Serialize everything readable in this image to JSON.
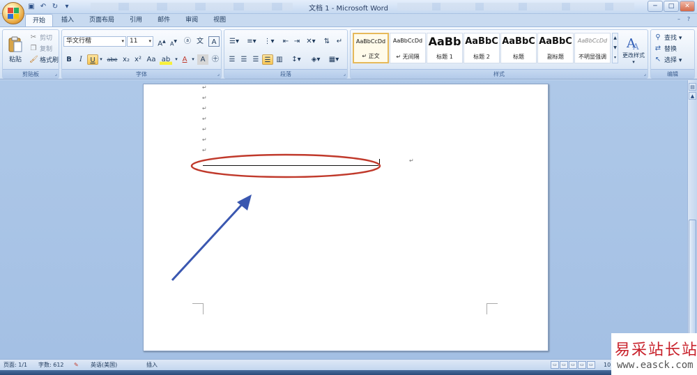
{
  "title_bar": {
    "doc_title": "文档 1 - Microsoft Word",
    "qat_icons": [
      "save-icon",
      "undo-icon",
      "redo-icon",
      "customize-icon"
    ],
    "window_buttons": [
      "─",
      "□",
      "✕"
    ]
  },
  "tabs": [
    {
      "label": "开始",
      "active": true
    },
    {
      "label": "插入"
    },
    {
      "label": "页面布局"
    },
    {
      "label": "引用"
    },
    {
      "label": "邮件"
    },
    {
      "label": "审阅"
    },
    {
      "label": "视图"
    }
  ],
  "ribbon": {
    "clipboard": {
      "label": "剪贴板",
      "paste": "粘贴",
      "cut": "剪切",
      "copy": "复制",
      "format_painter": "格式刷"
    },
    "font": {
      "label": "字体",
      "font_name": "华文行楷",
      "font_size": "11",
      "bold": "B",
      "italic": "I",
      "underline": "U",
      "strike": "abe",
      "sub": "x₂",
      "sup": "x²",
      "case": "Aa",
      "grow": "A",
      "shrink": "A",
      "clear": "A"
    },
    "paragraph": {
      "label": "段落"
    },
    "styles": {
      "label": "样式",
      "items": [
        {
          "sample": "AaBbCcDd",
          "name": "↵ 正文",
          "selected": true
        },
        {
          "sample": "AaBbCcDd",
          "name": "↵ 无间隔"
        },
        {
          "sample": "AaBb",
          "name": "标题 1"
        },
        {
          "sample": "AaBbC",
          "name": "标题 2"
        },
        {
          "sample": "AaBbC",
          "name": "标题"
        },
        {
          "sample": "AaBbC",
          "name": "副标题"
        },
        {
          "sample": "AaBbCcDd",
          "name": "不明显强调"
        }
      ],
      "change_styles": "更改样式"
    },
    "editing": {
      "label": "编辑",
      "find": "查找 ▾",
      "replace": "替换",
      "select": "选择 ▾"
    }
  },
  "document": {
    "para_mark": "↵"
  },
  "status_bar": {
    "page": "页面: 1/1",
    "words": "字数: 612",
    "language": "英语(美国)",
    "mode": "插入",
    "zoom": "10"
  },
  "watermark": {
    "text": "易采站长站",
    "url": "www.easck.com"
  },
  "colors": {
    "ellipse": "#c0392b",
    "arrow": "#3a57b0"
  }
}
